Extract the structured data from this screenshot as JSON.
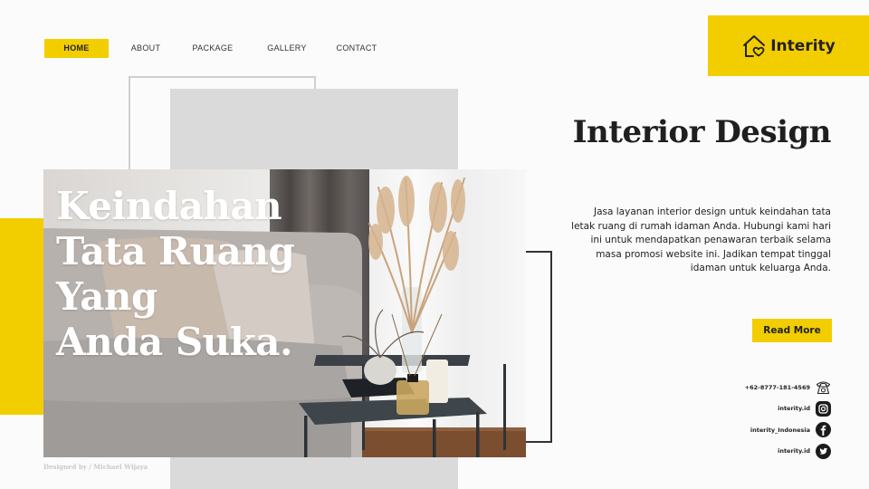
{
  "nav": {
    "items": [
      {
        "label": "HOME",
        "active": true
      },
      {
        "label": "ABOUT",
        "active": false
      },
      {
        "label": "PACKAGE",
        "active": false
      },
      {
        "label": "GALLERY",
        "active": false
      },
      {
        "label": "CONTACT",
        "active": false
      }
    ]
  },
  "brand": {
    "name": "Interity",
    "icon": "house-heart-icon",
    "accent_color": "#f2cd00"
  },
  "hero": {
    "headline_lines": [
      "Keindahan",
      "Tata Ruang",
      "Yang",
      "Anda Suka."
    ],
    "image_alt": "living room with grey sofa, cushions, side tables with pampas grass vase, candle and reed diffuser",
    "credit": "Designed by / Michael Wijaya"
  },
  "aside": {
    "title": "Interior Design",
    "description": "Jasa layanan interior design untuk keindahan tata letak ruang di rumah idaman Anda. Hubungi kami hari ini untuk mendapatkan penawaran terbaik selama masa promosi website ini. Jadikan tempat tinggal idaman untuk keluarga Anda.",
    "cta_label": "Read More"
  },
  "contacts": [
    {
      "text": "+62-8777-181-4569",
      "icon": "telephone-icon"
    },
    {
      "text": "interity.id",
      "icon": "instagram-icon"
    },
    {
      "text": "interity_Indonesia",
      "icon": "facebook-icon"
    },
    {
      "text": "interity.id",
      "icon": "twitter-icon"
    }
  ]
}
